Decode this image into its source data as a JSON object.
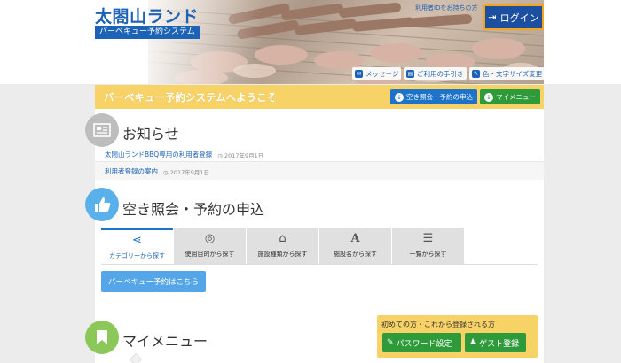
{
  "header": {
    "site_title": "太閤山ランド",
    "subtitle": "バーベキュー予約システム",
    "id_link": "利用者IDをお持ちの方",
    "login_label": "ログイン",
    "utilities": {
      "messages": "メッセージ",
      "guide": "ご利用の手引き",
      "display": "色・文字サイズ変更"
    }
  },
  "welcome": {
    "text": "バーベキュー予約システムへようこそ",
    "vacancy_label": "空き照会・予約の申込",
    "mymenu_label": "マイメニュー"
  },
  "news": {
    "title": "お知らせ",
    "items": [
      {
        "text": "太閤山ランドBBQ専用の利用者登録",
        "date": "2017年9月1日"
      },
      {
        "text": "利用者登録の案内",
        "date": "2017年9月1日"
      }
    ]
  },
  "reservation": {
    "title": "空き照会・予約の申込",
    "tabs": [
      {
        "label": "カテゴリーから探す",
        "icon": "share-icon"
      },
      {
        "label": "使用目的から探す",
        "icon": "compass-icon"
      },
      {
        "label": "施設種類から探す",
        "icon": "building-icon"
      },
      {
        "label": "施設名から探す",
        "icon": "font-icon"
      },
      {
        "label": "一覧から探す",
        "icon": "list-icon"
      }
    ],
    "bbq_button": "バーベキュー予約はこちら"
  },
  "mymenu": {
    "title": "マイメニュー",
    "first_time_caption": "初めての方・これから登録される方",
    "password_button": "パスワード設定",
    "guest_button": "ゲスト登録"
  },
  "colors": {
    "brand_blue": "#1d63b5",
    "accent_yellow": "#f7d267",
    "green": "#2f9a3a",
    "light_blue": "#55a6e8"
  }
}
